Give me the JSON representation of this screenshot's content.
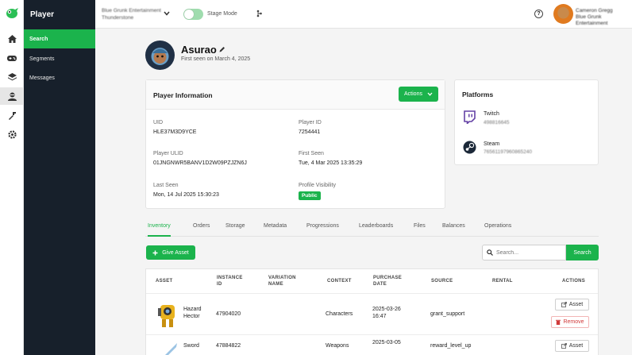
{
  "sidebar": {
    "title": "Player",
    "items": [
      {
        "label": "Search",
        "active": true
      },
      {
        "label": "Segments"
      },
      {
        "label": "Messages"
      }
    ],
    "rail_icons": [
      "home-icon",
      "gamepad-icon",
      "layers-icon",
      "player-icon",
      "tools-icon",
      "settings-icon"
    ]
  },
  "header": {
    "org_line1": "Blue Grunk Entertainment",
    "org_line2": "Thunderstone",
    "stage_mode_label": "Stage Mode",
    "help_label": "?",
    "user_line1": "Cameron Gregg",
    "user_line2": "Blue Grunk Entertainment"
  },
  "profile": {
    "name": "Asurao",
    "first_seen": "First seen on March 4, 2025"
  },
  "player_info": {
    "title": "Player Information",
    "actions_label": "Actions",
    "uid_label": "UID",
    "uid": "HLE37M3D9YCE",
    "player_id_label": "Player ID",
    "player_id": "7254441",
    "ulid_label": "Player ULID",
    "ulid": "01JNGNWR5BANV1D2W09PZJZN6J",
    "first_seen_label": "First Seen",
    "first_seen": "Tue, 4 Mar 2025 13:35:29",
    "last_seen_label": "Last Seen",
    "last_seen": "Mon, 14 Jul 2025 15:30:23",
    "visibility_label": "Profile Visibility",
    "visibility": "Public"
  },
  "platforms": {
    "title": "Platforms",
    "items": [
      {
        "name": "Twitch",
        "id": "498816645",
        "icon": "twitch-icon"
      },
      {
        "name": "Steam",
        "id": "76561197960865240",
        "icon": "steam-icon"
      }
    ]
  },
  "tabs": [
    {
      "label": "Inventory",
      "active": true
    },
    {
      "label": "Orders"
    },
    {
      "label": "Storage"
    },
    {
      "label": "Metadata"
    },
    {
      "label": "Progressions"
    },
    {
      "label": "Leaderboards"
    },
    {
      "label": "Files"
    },
    {
      "label": "Balances"
    },
    {
      "label": "Operations"
    }
  ],
  "inventory": {
    "give_asset_label": "Give Asset",
    "search_placeholder": "Search...",
    "search_button": "Search",
    "columns": {
      "asset": "ASSET",
      "instance_id_1": "INSTANCE",
      "instance_id_2": "ID",
      "variation_1": "VARIATION",
      "variation_2": "NAME",
      "context": "CONTEXT",
      "purchase_1": "PURCHASE",
      "purchase_2": "DATE",
      "source": "SOURCE",
      "rental": "RENTAL",
      "actions": "ACTIONS"
    },
    "rows": [
      {
        "name1": "Hazard",
        "name2": "Hector",
        "instance_id": "47904020",
        "context": "Characters",
        "date1": "2025-03-26",
        "date2": "16:47",
        "source": "grant_support",
        "asset_btn": "Asset",
        "remove_btn": "Remove"
      },
      {
        "name1": "Sword",
        "name2": "",
        "instance_id": "47884822",
        "context": "Weapons",
        "date1": "2025-03-05",
        "date2": "",
        "source": "reward_level_up",
        "asset_btn": "Asset"
      }
    ]
  },
  "colors": {
    "accent": "#1bb34c",
    "sidebar_bg": "#17202b",
    "danger": "#d03a3a"
  }
}
